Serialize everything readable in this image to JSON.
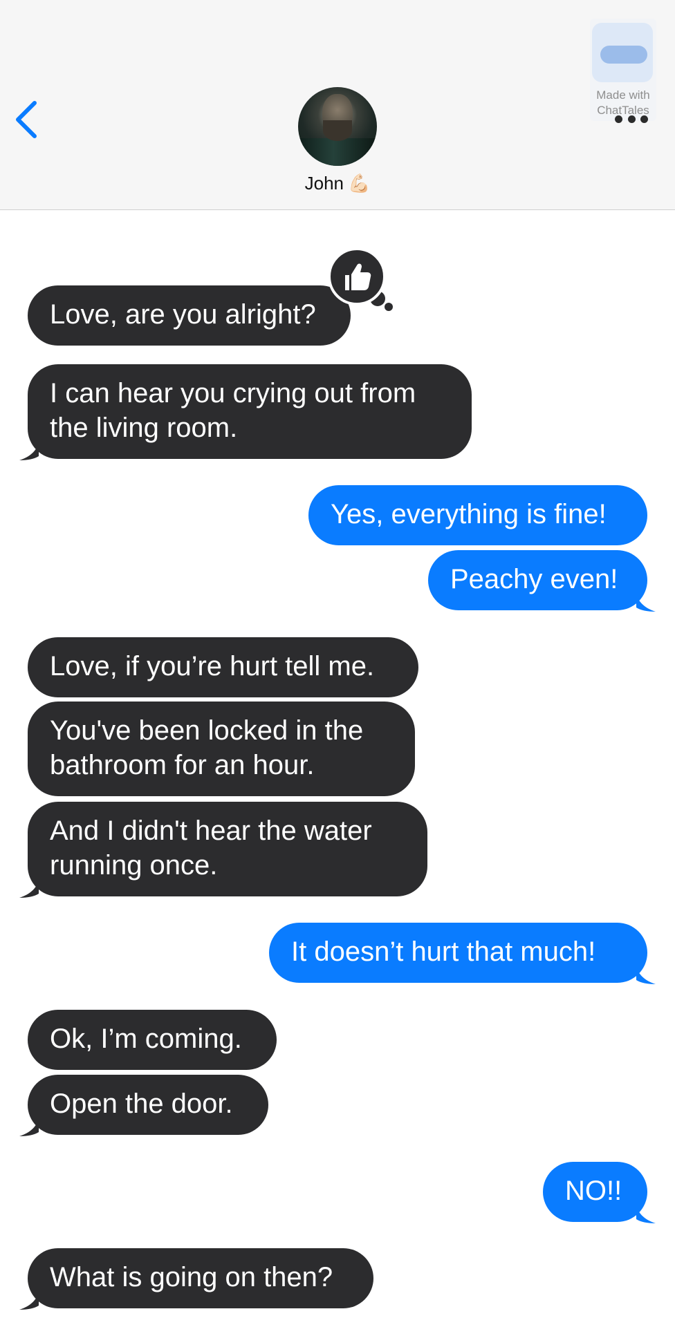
{
  "header": {
    "back_icon": "chevron-left-icon",
    "contact": {
      "name": "John",
      "emoji": "💪🏻"
    },
    "watermark": {
      "line1": "Made with",
      "line2": "ChatTales"
    },
    "more_icon": "ellipsis-icon"
  },
  "colors": {
    "incoming": "#2c2c2e",
    "outgoing": "#0a7cff",
    "accent": "#0a7cff"
  },
  "reaction": {
    "icon": "thumbs-up-icon"
  },
  "messages": [
    {
      "from": "contact",
      "text": "Love, are you alright?"
    },
    {
      "from": "contact",
      "line1": "I can hear you crying out from",
      "line2": "the living room."
    },
    {
      "from": "me",
      "text": "Yes, everything is fine!"
    },
    {
      "from": "me",
      "text": "Peachy even!"
    },
    {
      "from": "contact",
      "text": "Love, if you’re hurt tell me."
    },
    {
      "from": "contact",
      "line1": "You've been locked in the",
      "line2": "bathroom for an hour."
    },
    {
      "from": "contact",
      "line1": "And I didn't hear the water",
      "line2": "running once."
    },
    {
      "from": "me",
      "text": "It doesn’t hurt that much!"
    },
    {
      "from": "contact",
      "text": "Ok, I’m coming."
    },
    {
      "from": "contact",
      "text": "Open the door."
    },
    {
      "from": "me",
      "text": "NO!!"
    },
    {
      "from": "contact",
      "text": "What is going on then?"
    }
  ]
}
